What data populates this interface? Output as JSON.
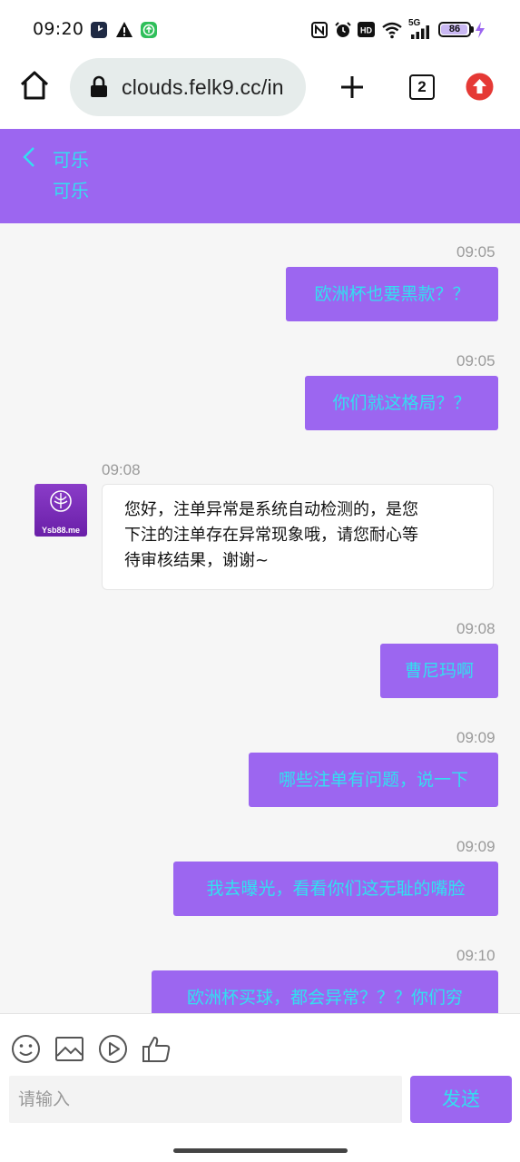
{
  "status_bar": {
    "time": "09:20",
    "network": "5G",
    "battery": "86",
    "icons": [
      "clock-app-icon",
      "warning-icon",
      "update-icon",
      "nfc-icon",
      "alarm-icon",
      "hd-icon",
      "wifi-icon",
      "signal-icon",
      "battery-icon",
      "charging-icon"
    ]
  },
  "browser": {
    "url": "clouds.felk9.cc/in",
    "tab_count": "2",
    "icons": [
      "home-icon",
      "lock-icon",
      "plus-icon",
      "tabs-icon",
      "update-icon"
    ]
  },
  "header": {
    "title": "可乐",
    "subtitle": "可乐",
    "back_icon": "chevron-left-icon"
  },
  "messages": [
    {
      "direction": "out",
      "time": "09:05",
      "text": "欧洲杯也要黑款？？"
    },
    {
      "direction": "out",
      "time": "09:05",
      "text": "你们就这格局？？"
    },
    {
      "direction": "in",
      "time": "09:08",
      "sender_avatar": "Ysb88.me",
      "lines": [
        "您好，注单异常是系统自动检测的，是您",
        "下注的注单存在异常现象哦，请您耐心等",
        "待审核结果，谢谢~"
      ]
    },
    {
      "direction": "out",
      "time": "09:08",
      "text": "曹尼玛啊"
    },
    {
      "direction": "out",
      "time": "09:09",
      "text": "哪些注单有问题，说一下"
    },
    {
      "direction": "out",
      "time": "09:09",
      "text": "我去曝光，看看你们这无耻的嘴脸"
    },
    {
      "direction": "out",
      "time": "09:10",
      "text": "欧洲杯买球，都会异常？？？你们穷"
    }
  ],
  "composer": {
    "placeholder": "请输入",
    "send_label": "发送",
    "tools": [
      "emoji-icon",
      "image-icon",
      "video-icon",
      "thumbs-up-icon"
    ]
  },
  "colors": {
    "accent": "#9c66f0",
    "accent_text": "#32e0f0",
    "timestamp": "#9a9a9a",
    "chat_bg": "#f6f6f6"
  }
}
